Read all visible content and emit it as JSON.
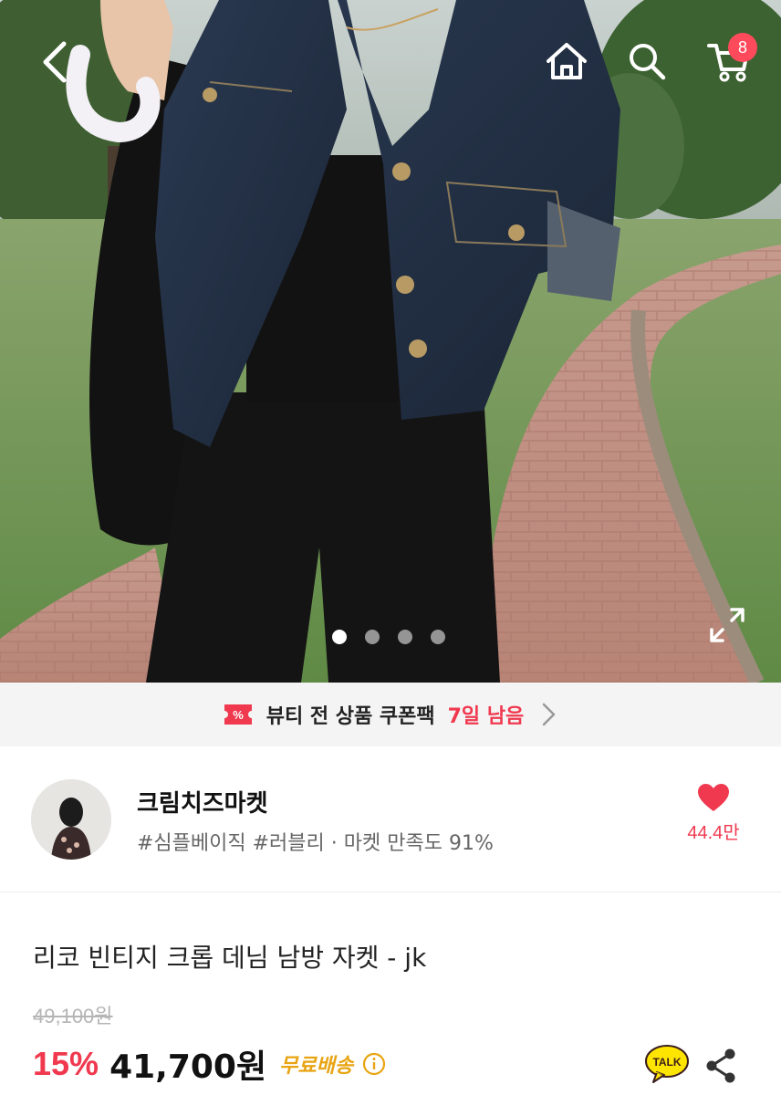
{
  "topbar": {
    "cart_count": "8"
  },
  "gallery": {
    "total_images": 4,
    "active_index": 0
  },
  "coupon_banner": {
    "text": "뷰티 전 상품 쿠폰팩",
    "days_left": "7일 남음"
  },
  "shop": {
    "name": "크림치즈마켓",
    "tags": "#심플베이직 #러블리 · 마켓 만족도 91%",
    "likes": "44.4만"
  },
  "product": {
    "title": "리코 빈티지 크롭 데님 남방 자켓 - jk",
    "original_price": "49,100원",
    "discount": "15%",
    "price": "41,700원",
    "shipping": "무료배송"
  },
  "colors": {
    "accent_red": "#f0394f",
    "shipping_gold": "#e8a412",
    "kakao_yellow": "#fee500"
  }
}
